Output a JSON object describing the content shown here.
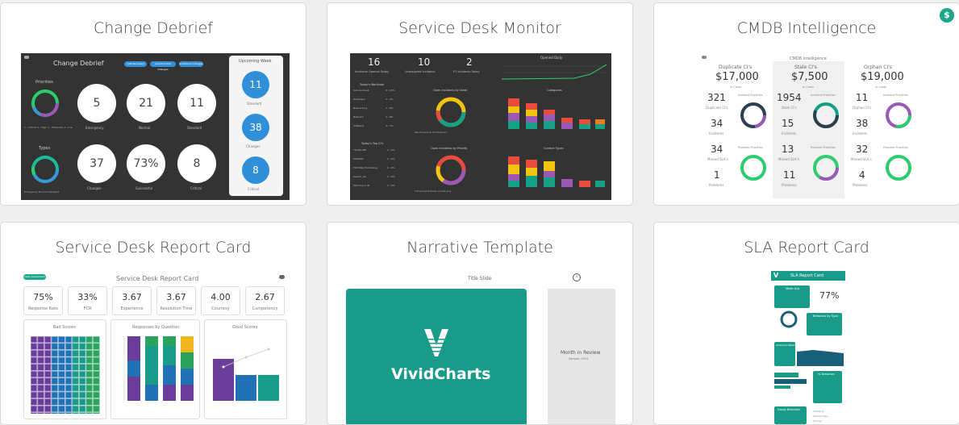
{
  "badge": {
    "symbol": "$"
  },
  "colors": {
    "teal": "#1a9b8a",
    "blue": "#2f8fd9",
    "dark": "#333333"
  },
  "cards": [
    {
      "title": "Change Debrief"
    },
    {
      "title": "Service Desk Monitor"
    },
    {
      "title": "CMDB Intelligence"
    },
    {
      "title": "Service Desk Report Card"
    },
    {
      "title": "Narrative Template"
    },
    {
      "title": "SLA Report Card"
    }
  ],
  "change_debrief": {
    "heading": "Change Debrief",
    "pills": [
      "CAB Reviewed",
      "Unauthorized Changes",
      "Scheduled Changes"
    ],
    "priorities_label": "Priorities",
    "priorities_legend": "1 - Critical  2 - High  3 - Moderate  4 - Low",
    "types_label": "Types",
    "types_legend": "Emergency  Normal  Standard",
    "stats_row1": [
      {
        "v": "5",
        "l": "Emergency"
      },
      {
        "v": "21",
        "l": "Normal"
      },
      {
        "v": "11",
        "l": "Standard"
      }
    ],
    "stats_row2": [
      {
        "v": "37",
        "l": "Changes"
      },
      {
        "v": "73%",
        "l": "Successful"
      },
      {
        "v": "8",
        "l": "Critical"
      }
    ],
    "week": {
      "title": "Upcoming Week",
      "items": [
        {
          "v": "11",
          "l": "Standard"
        },
        {
          "v": "38",
          "l": "Changes"
        },
        {
          "v": "8",
          "l": "Critical"
        }
      ]
    }
  },
  "service_desk_monitor": {
    "stats": [
      {
        "v": "16",
        "l": "Incidents Opened Today"
      },
      {
        "v": "10",
        "l": "Unassigned Incidents"
      },
      {
        "v": "2",
        "l": "P1 Incidents Today"
      }
    ],
    "opened_daily": "Opened Daily",
    "workload_title": "Today's Workload",
    "workload": [
      {
        "n": "Service Desk",
        "v": "4 - 15%"
      },
      {
        "n": "Hardware",
        "v": "3 - 9%"
      },
      {
        "n": "Networking",
        "v": "2 - 8%"
      },
      {
        "n": "Network",
        "v": "2 - 6%"
      },
      {
        "n": "Software",
        "v": "2 - 7%"
      }
    ],
    "top_ci_title": "Today's Top CI's",
    "top_ci": [
      {
        "n": "*SCAD-MFI",
        "v": "1 - 6%"
      },
      {
        "n": "OWS001",
        "v": "1 - 6%"
      },
      {
        "n": "FSS Web Processing",
        "v": "1 - 6%"
      },
      {
        "n": "Search_db",
        "v": "1 - 6%"
      },
      {
        "n": "Machine or IP",
        "v": "1 - 6%"
      }
    ],
    "donut1": "Open Incidents by State",
    "donut2": "Open Incidents by Priority",
    "bar1": "Categories",
    "bar2": "Contact Types",
    "legend1": "New  Progress  On Hold  Resolved",
    "legend2": "Critical  High  Moderate  Low  Planning"
  },
  "cmdb": {
    "heading": "CMDB Intelligence",
    "cols": [
      {
        "name": "Duplicate CI's",
        "amount": "$17,000",
        "sub": "in Costs",
        "rows": [
          {
            "v": "321",
            "l": "Duplicate CI's"
          },
          {
            "v": "34",
            "l": "Incidents"
          },
          {
            "v": "34",
            "l": "Missed SLA's"
          },
          {
            "v": "1",
            "l": "Problems"
          }
        ]
      },
      {
        "name": "Stale CI's",
        "amount": "$7,500",
        "sub": "in Costs",
        "rows": [
          {
            "v": "1954",
            "l": "Stale CI's"
          },
          {
            "v": "15",
            "l": "Incidents"
          },
          {
            "v": "13",
            "l": "Missed SLA's"
          },
          {
            "v": "11",
            "l": "Problems"
          }
        ]
      },
      {
        "name": "Orphan CI's",
        "amount": "$19,000",
        "sub": "in Costs",
        "rows": [
          {
            "v": "11",
            "l": "Orphan CI's"
          },
          {
            "v": "38",
            "l": "Incidents"
          },
          {
            "v": "32",
            "l": "Missed SLA's"
          },
          {
            "v": "4",
            "l": "Problems"
          }
        ]
      }
    ],
    "incident_priorities": "Incident Priorities",
    "problem_priorities": "Problem Priorities"
  },
  "report_card": {
    "pill": "Data Adjustment",
    "heading": "Service Desk Report Card",
    "kpis": [
      {
        "v": "75%",
        "l": "Response Rate"
      },
      {
        "v": "33%",
        "l": "FCR"
      },
      {
        "v": "3.67",
        "l": "Experience"
      },
      {
        "v": "3.67",
        "l": "Resolution Time"
      },
      {
        "v": "4.00",
        "l": "Courtesy"
      },
      {
        "v": "2.67",
        "l": "Competency"
      }
    ],
    "panels": [
      "Bad Scores",
      "Responses by Question",
      "Good Scores"
    ]
  },
  "narrative": {
    "slide_label": "Title Slide",
    "logo": "VividCharts",
    "side_title": "Month in Review",
    "side_sub": "Sample, 2019"
  },
  "sla": {
    "heading": "SLA Report Card",
    "pct": "77%",
    "sections": [
      "Made SLA",
      "Breaches by Type",
      "Achieved Weekly",
      "% Breaches",
      "Group Breaches"
    ],
    "group_rows": [
      "Category",
      "Service Type",
      "Priority"
    ]
  }
}
